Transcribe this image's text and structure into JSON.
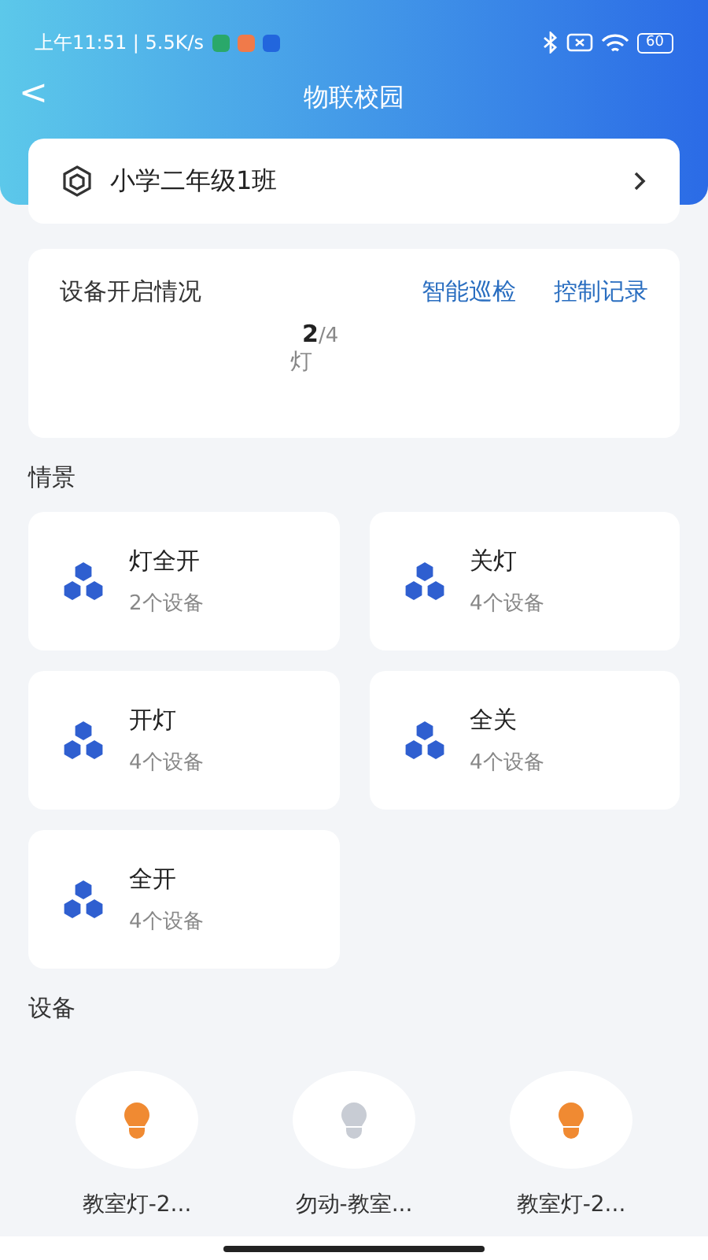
{
  "status_bar": {
    "time": "上午11:51 | 5.5K/s",
    "battery": "60"
  },
  "nav": {
    "back": "<",
    "title": "物联校园"
  },
  "class_selector": {
    "label": "小学二年级1班"
  },
  "overview": {
    "title": "设备开启情况",
    "links": [
      "智能巡检",
      "控制记录"
    ],
    "on_count": "2",
    "total": "/4",
    "type": "灯"
  },
  "scenes_heading": "情景",
  "scenes": [
    {
      "name": "灯全开",
      "count": "2个设备"
    },
    {
      "name": "关灯",
      "count": "4个设备"
    },
    {
      "name": "开灯",
      "count": "4个设备"
    },
    {
      "name": "全关",
      "count": "4个设备"
    },
    {
      "name": "全开",
      "count": "4个设备"
    }
  ],
  "devices_heading": "设备",
  "devices": [
    {
      "name": "教室灯-2...",
      "on": true
    },
    {
      "name": "勿动-教室...",
      "on": false
    },
    {
      "name": "教室灯-2...",
      "on": true
    }
  ]
}
